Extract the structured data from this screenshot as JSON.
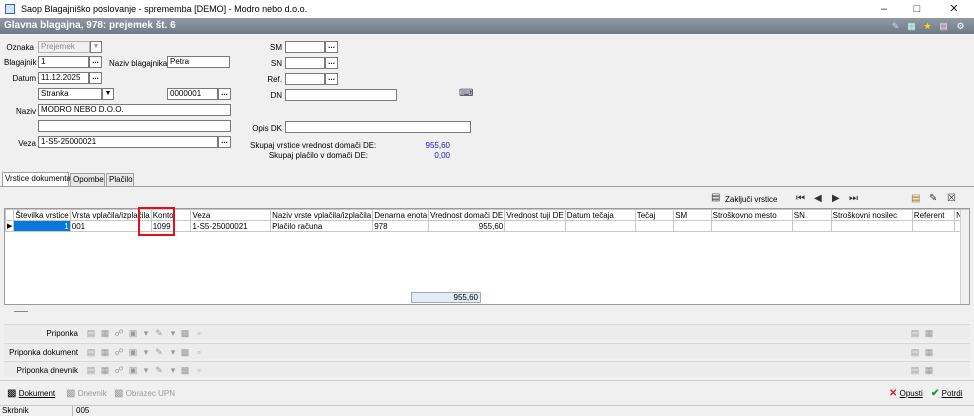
{
  "window": {
    "title": "Saop Blagajniško poslovanje - sprememba [DEMO] - Modro nebo d.o.o."
  },
  "header": {
    "title": "Glavna blagajna, 978: prejemek št. 6"
  },
  "form": {
    "oznaka_label": "Oznaka",
    "oznaka_value": "Prejemek",
    "blagajnik_label": "Blagajnik",
    "blagajnik_value": "1",
    "naziv_blagajnika_label": "Naziv blagajnika",
    "naziv_blagajnika_value": "Petra",
    "datum_label": "Datum",
    "datum_value": "11.12.2025",
    "stranka_value": "Stranka",
    "stranka_code": "0000001",
    "naziv_label": "Naziv",
    "naziv_value": "MODRO NEBO D.O.O.",
    "naziv2_value": "",
    "veza_label": "Veza",
    "veza_value": "1-S5-25000021",
    "sm_label": "SM",
    "sn_label": "SN",
    "ref_label": "Ref.",
    "dn_label": "DN",
    "opis_dk_label": "Opis DK",
    "skupaj_vrstice_label": "Skupaj vrstice vrednost domači DE:",
    "skupaj_vrstice_value": "955,60",
    "skupaj_placilo_label": "Skupaj plačilo v domači DE:",
    "skupaj_placilo_value": "0,00"
  },
  "tabs": [
    {
      "label": "Vrstice dokumenta"
    },
    {
      "label": "Opombe"
    },
    {
      "label": "Plačilo"
    }
  ],
  "toolbar": {
    "zakljuci_label": "Zaključi vrstice"
  },
  "grid": {
    "columns": [
      "Številka vrstice",
      "Vrsta vplačila/izplačila",
      "Konto",
      "Veza",
      "Naziv vrste vplačila/izplačila",
      "Denarna enota",
      "Vrednost domači DE",
      "Vrednost tuji DE",
      "Datum tečaja",
      "Tečaj",
      "SM",
      "Stroškovno mesto",
      "SN",
      "Stroškovni nosilec",
      "Referent",
      "Na"
    ],
    "rows": [
      [
        "1",
        "001",
        "1099",
        "1-S5-25000021",
        "Plačilo računa",
        "978",
        "955,60",
        "",
        "",
        "",
        "",
        "",
        "",
        "",
        "",
        ""
      ]
    ],
    "sum_value": "955,60"
  },
  "attachments": [
    {
      "label": "Priponka"
    },
    {
      "label": "Priponka dokument"
    },
    {
      "label": "Priponka dnevnik"
    }
  ],
  "bottom": {
    "dokument_label": "Dokument",
    "dnevnik_label": "Dnevnik",
    "obrazec_label": "Obrazec UPN",
    "opusti_label": "Opusti",
    "potrdi_label": "Potrdi"
  },
  "status": {
    "left": "Skrbnik",
    "right": "005"
  },
  "colors": {
    "header_bg": "#7f8a96",
    "selection": "#0a78d7",
    "highlight_box": "#e0101c",
    "sum_text": "#1a1ab0"
  }
}
